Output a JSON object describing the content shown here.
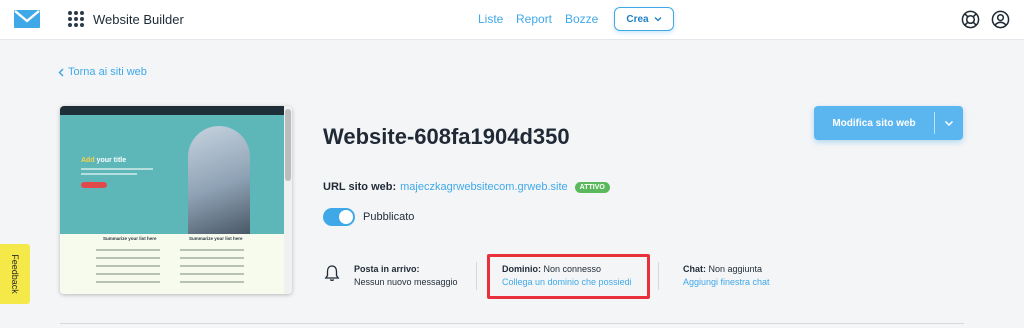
{
  "header": {
    "app_title": "Website Builder",
    "nav": [
      "Liste",
      "Report",
      "Bozze"
    ],
    "create_label": "Crea"
  },
  "back_link": "Torna ai siti web",
  "preview": {
    "hero_title_accent": "Add",
    "hero_title_rest": " your title",
    "subtitle_left": "Summarize your list here",
    "subtitle_right": "Summarize your list here"
  },
  "site": {
    "title": "Website-608fa1904d350",
    "url_label": "URL sito web:",
    "url_value": "majeczkagrwebsitecom.grweb.site",
    "status_badge": "ATTIVO",
    "published_label": "Pubblicato",
    "published": true
  },
  "edit_button": {
    "label": "Modifica sito web"
  },
  "info": {
    "inbox_label": "Posta in arrivo:",
    "inbox_text": "Nessun nuovo messaggio",
    "domain_label": "Dominio:",
    "domain_status": "Non connesso",
    "domain_link": "Collega un dominio che possiedi",
    "chat_label": "Chat:",
    "chat_status": "Non aggiunta",
    "chat_link": "Aggiungi finestra chat"
  },
  "feedback_label": "Feedback",
  "colors": {
    "accent": "#3fa9e8",
    "button": "#5bb6f0",
    "badge": "#5cb85c",
    "highlight": "#e8313a",
    "feedback": "#f5e94a"
  }
}
